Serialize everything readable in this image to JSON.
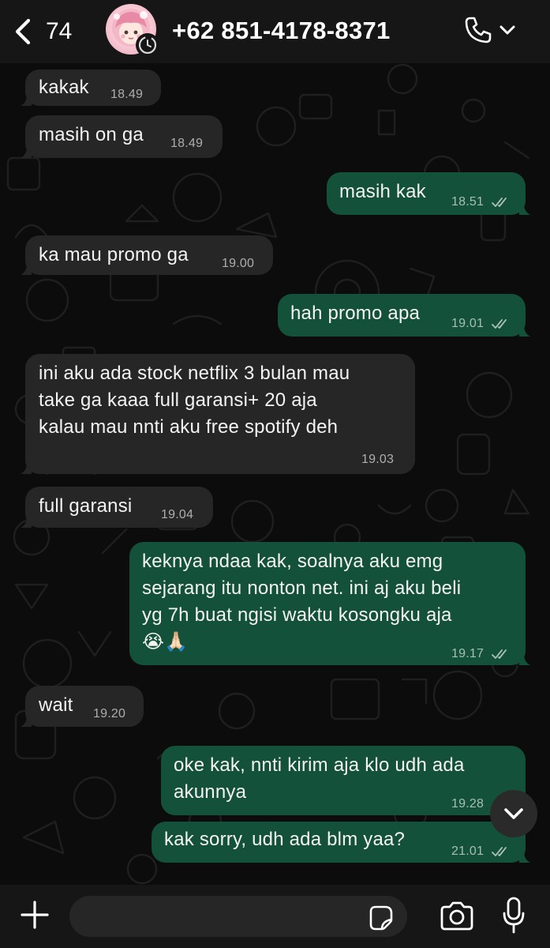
{
  "header": {
    "unread_count": "74",
    "contact_name": "+62 851-4178-8371"
  },
  "messages": [
    {
      "dir": "in",
      "lines": [
        "kakak"
      ],
      "time": "18.49"
    },
    {
      "dir": "in",
      "lines": [
        "masih on ga"
      ],
      "time": "18.49"
    },
    {
      "dir": "out",
      "lines": [
        "masih kak"
      ],
      "time": "18.51",
      "read": true
    },
    {
      "dir": "in",
      "lines": [
        "ka mau promo ga"
      ],
      "time": "19.00"
    },
    {
      "dir": "out",
      "lines": [
        "hah promo apa"
      ],
      "time": "19.01",
      "read": true
    },
    {
      "dir": "in",
      "lines": [
        "ini aku ada stock netflix 3 bulan mau",
        "take ga kaaa full garansi+ 20 aja",
        "kalau mau nnti aku free spotify deh"
      ],
      "time": "19.03"
    },
    {
      "dir": "in",
      "lines": [
        "full garansi"
      ],
      "time": "19.04"
    },
    {
      "dir": "out",
      "lines": [
        "keknya ndaa kak, soalnya aku emg",
        "sejarang itu nonton net. ini aj aku beli",
        "yg 7h buat ngisi waktu kosongku aja",
        "😭🙏🏻"
      ],
      "time": "19.17",
      "read": true
    },
    {
      "dir": "in",
      "lines": [
        "wait"
      ],
      "time": "19.20"
    },
    {
      "dir": "out",
      "lines": [
        "oke kak, nnti kirim aja klo udh ada",
        "akunnya"
      ],
      "time": "19.28",
      "read": true
    },
    {
      "dir": "out",
      "lines": [
        "kak sorry, udh ada blm yaa?"
      ],
      "time": "21.01",
      "read": true
    }
  ],
  "composer": {
    "placeholder": ""
  },
  "icons": {
    "back": "chevron-left-icon",
    "call": "phone-icon",
    "scroll": "chevron-down-icon",
    "plus": "plus-icon",
    "sticker": "sticker-icon",
    "camera": "camera-icon",
    "mic": "microphone-icon"
  },
  "colors": {
    "incoming_bubble": "#262626",
    "outgoing_bubble": "#14513a",
    "background": "#0c0c0c",
    "bar": "#161616"
  }
}
